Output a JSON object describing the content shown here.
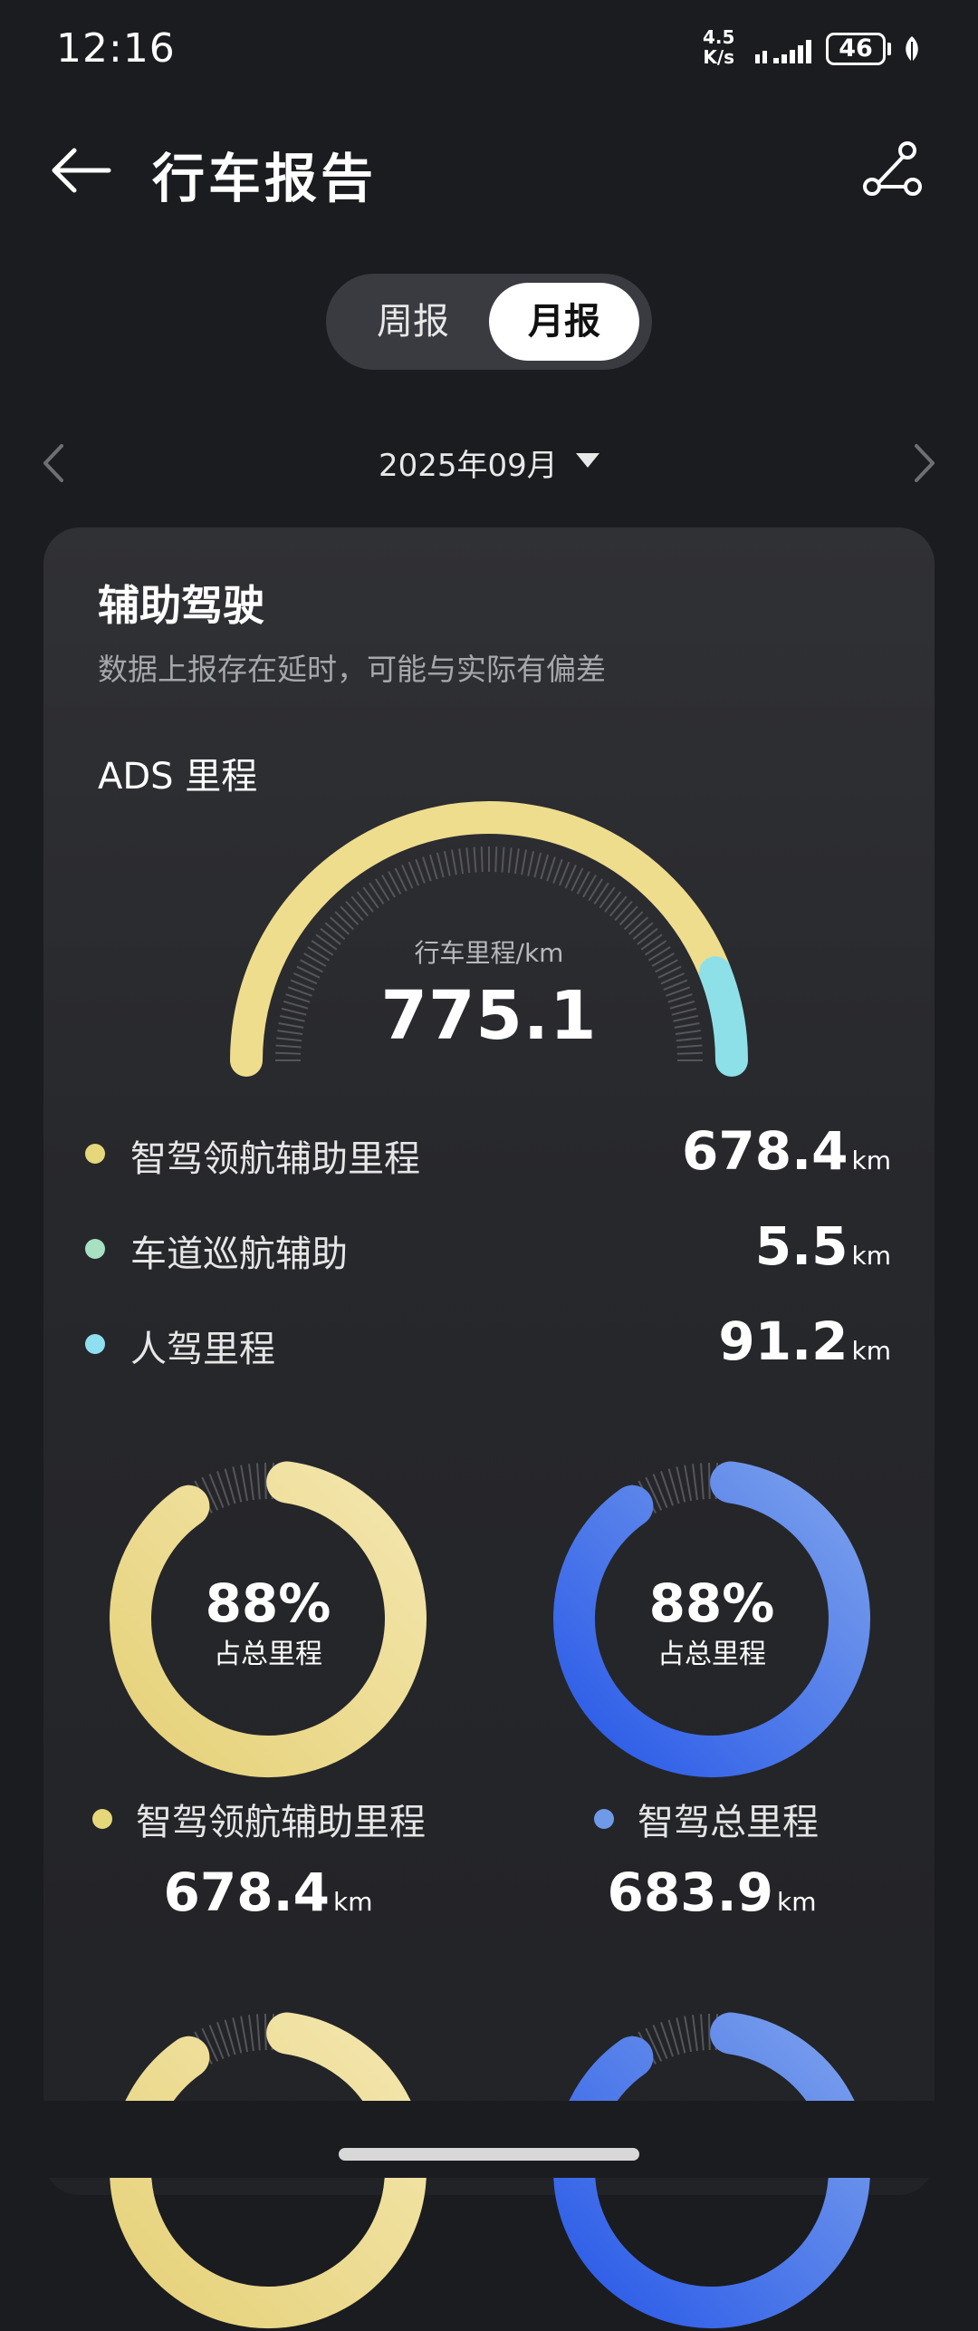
{
  "status_bar": {
    "time": "12:16",
    "net_speed_value": "4.5",
    "net_speed_unit": "K/s",
    "battery": "46"
  },
  "header": {
    "title": "行车报告",
    "back_icon": "arrow-left-icon",
    "share_icon": "share-icon"
  },
  "period_tabs": [
    {
      "label": "周报",
      "selected": false
    },
    {
      "label": "月报",
      "selected": true
    }
  ],
  "month_selector": {
    "label": "2025年09月"
  },
  "card": {
    "title": "辅助驾驶",
    "note": "数据上报存在延时，可能与实际有偏差",
    "ads_title": "ADS 里程",
    "gauge": {
      "caption": "行车里程/km",
      "total": "775.1",
      "segments": [
        {
          "name": "智驾领航辅助里程",
          "value": 678.4,
          "color": "#efdd8e"
        },
        {
          "name": "车道巡航辅助",
          "value": 5.5,
          "color": "#a8e0c2"
        },
        {
          "name": "人驾里程",
          "value": 91.2,
          "color": "#8ee0e8"
        }
      ]
    },
    "legend": [
      {
        "label": "智驾领航辅助里程",
        "value": "678.4",
        "unit": "km",
        "color": "#e6d77a"
      },
      {
        "label": "车道巡航辅助",
        "value": "5.5",
        "unit": "km",
        "color": "#a8e0c2"
      },
      {
        "label": "人驾里程",
        "value": "91.2",
        "unit": "km",
        "color": "#8ee0f0"
      }
    ],
    "rings": [
      {
        "percent": "88%",
        "fraction": 0.88,
        "sub": "占总里程",
        "label": "智驾领航辅助里程",
        "value": "678.4",
        "unit": "km",
        "dot_color": "#e6d77a",
        "color_start": "#e6d27a",
        "color_end": "#f3e6ad"
      },
      {
        "percent": "88%",
        "fraction": 0.88,
        "sub": "占总里程",
        "label": "智驾总里程",
        "value": "683.9",
        "unit": "km",
        "dot_color": "#6f9ae8",
        "color_start": "#2a5ae8",
        "color_end": "#7aa0ec"
      }
    ]
  }
}
